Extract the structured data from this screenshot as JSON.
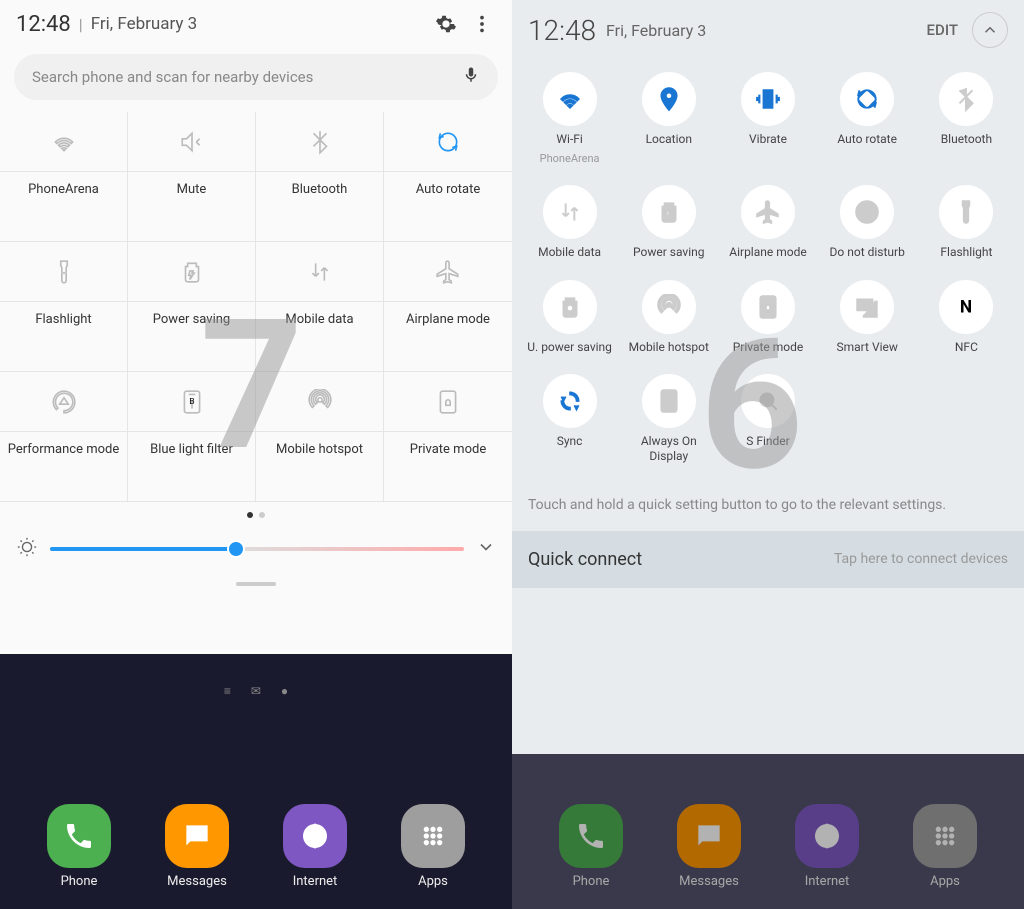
{
  "left": {
    "time": "12:48",
    "date": "Fri, February 3",
    "search_placeholder": "Search phone and scan for nearby devices",
    "tiles": [
      {
        "name": "wifi",
        "label": "PhoneArena",
        "active": false
      },
      {
        "name": "mute",
        "label": "Mute",
        "active": false
      },
      {
        "name": "bluetooth",
        "label": "Bluetooth",
        "active": false
      },
      {
        "name": "autorotate",
        "label": "Auto rotate",
        "active": true
      },
      {
        "name": "flashlight",
        "label": "Flashlight",
        "active": false
      },
      {
        "name": "powersaving",
        "label": "Power saving",
        "active": false
      },
      {
        "name": "mobiledata",
        "label": "Mobile data",
        "active": false
      },
      {
        "name": "airplane",
        "label": "Airplane mode",
        "active": false
      },
      {
        "name": "performance",
        "label": "Performance mode",
        "active": false
      },
      {
        "name": "bluelight",
        "label": "Blue light filter",
        "active": false
      },
      {
        "name": "hotspot",
        "label": "Mobile hotspot",
        "active": false
      },
      {
        "name": "private",
        "label": "Private mode",
        "active": false
      }
    ],
    "overlay": "7"
  },
  "right": {
    "time": "12:48",
    "date": "Fri, February 3",
    "edit": "EDIT",
    "tiles": [
      {
        "name": "wifi",
        "label": "Wi-Fi",
        "sub": "PhoneArena",
        "active": true
      },
      {
        "name": "location",
        "label": "Location",
        "sub": "",
        "active": true
      },
      {
        "name": "vibrate",
        "label": "Vibrate",
        "sub": "",
        "active": true
      },
      {
        "name": "autorotate",
        "label": "Auto rotate",
        "sub": "",
        "active": true
      },
      {
        "name": "bluetooth",
        "label": "Bluetooth",
        "sub": "",
        "active": false
      },
      {
        "name": "mobiledata",
        "label": "Mobile data",
        "sub": "",
        "active": false
      },
      {
        "name": "powersaving",
        "label": "Power saving",
        "sub": "",
        "active": false
      },
      {
        "name": "airplane",
        "label": "Airplane mode",
        "sub": "",
        "active": false
      },
      {
        "name": "dnd",
        "label": "Do not disturb",
        "sub": "",
        "active": false
      },
      {
        "name": "flashlight",
        "label": "Flashlight",
        "sub": "",
        "active": false
      },
      {
        "name": "upowersaving",
        "label": "U. power saving",
        "sub": "",
        "active": false
      },
      {
        "name": "hotspot",
        "label": "Mobile hotspot",
        "sub": "",
        "active": false
      },
      {
        "name": "private",
        "label": "Private mode",
        "sub": "",
        "active": false
      },
      {
        "name": "smartview",
        "label": "Smart View",
        "sub": "",
        "active": false
      },
      {
        "name": "nfc",
        "label": "NFC",
        "sub": "",
        "active": true
      },
      {
        "name": "sync",
        "label": "Sync",
        "sub": "",
        "active": true
      },
      {
        "name": "aod",
        "label": "Always On Display",
        "sub": "",
        "active": false
      },
      {
        "name": "sfinder",
        "label": "S Finder",
        "sub": "",
        "active": false
      }
    ],
    "hint": "Touch and hold a quick setting button to go to the relevant settings.",
    "qc_title": "Quick connect",
    "qc_sub": "Tap here to connect devices",
    "overlay": "6"
  },
  "dock": [
    {
      "name": "phone",
      "label": "Phone",
      "color": "#4caf50"
    },
    {
      "name": "messages",
      "label": "Messages",
      "color": "#ff9800"
    },
    {
      "name": "internet",
      "label": "Internet",
      "color": "#7e57c2"
    },
    {
      "name": "apps",
      "label": "Apps",
      "color": "#9e9e9e"
    }
  ]
}
